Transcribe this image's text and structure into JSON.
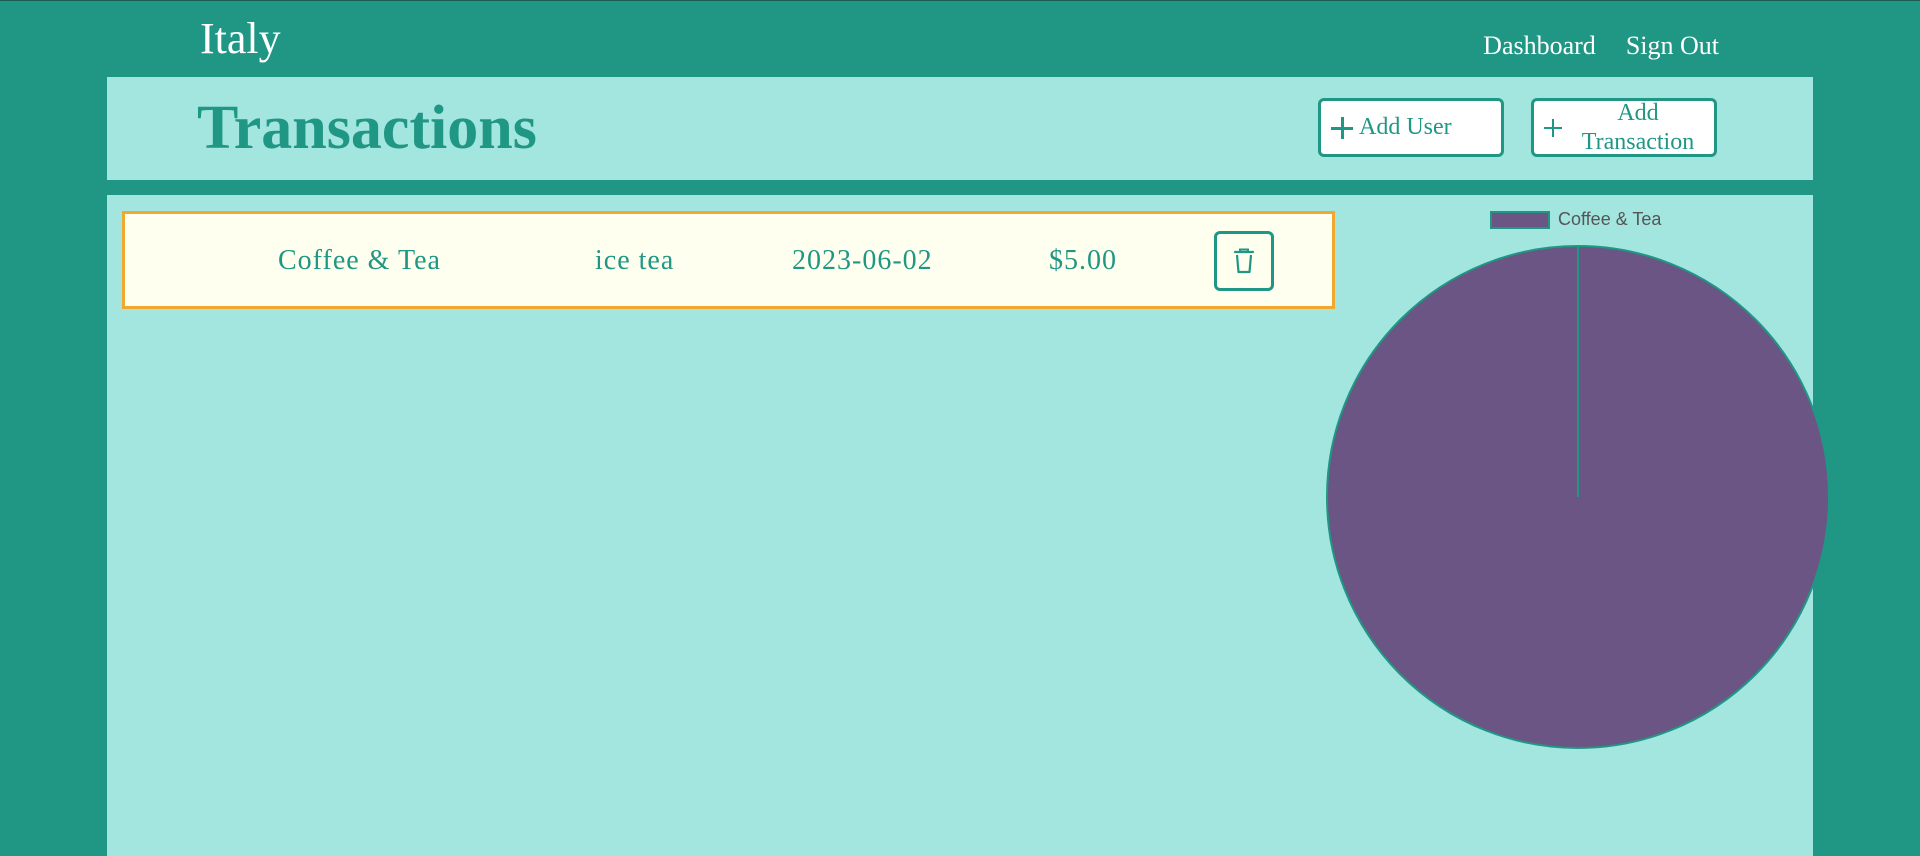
{
  "header": {
    "brand": "Italy",
    "nav": [
      {
        "label": "Dashboard"
      },
      {
        "label": "Sign Out"
      }
    ]
  },
  "page": {
    "title": "Transactions",
    "add_user_label": "Add User",
    "add_transaction_label": "Add Transaction"
  },
  "transactions": [
    {
      "category": "Coffee & Tea",
      "description": "ice tea",
      "date": "2023-06-02",
      "amount": "$5.00"
    }
  ],
  "chart_data": {
    "type": "pie",
    "labels": [
      "Coffee & Tea"
    ],
    "values": [
      5.0
    ],
    "colors": [
      "#6a5585"
    ],
    "border_color": "#1f9784",
    "legend_position": "top"
  },
  "colors": {
    "primary": "#1f9784",
    "panel": "#a3e5df",
    "row_bg": "#fffff0",
    "row_border": "#f0a830",
    "slice": "#6a5585"
  },
  "icons": {
    "add": "plus-icon",
    "delete": "trash-icon"
  }
}
